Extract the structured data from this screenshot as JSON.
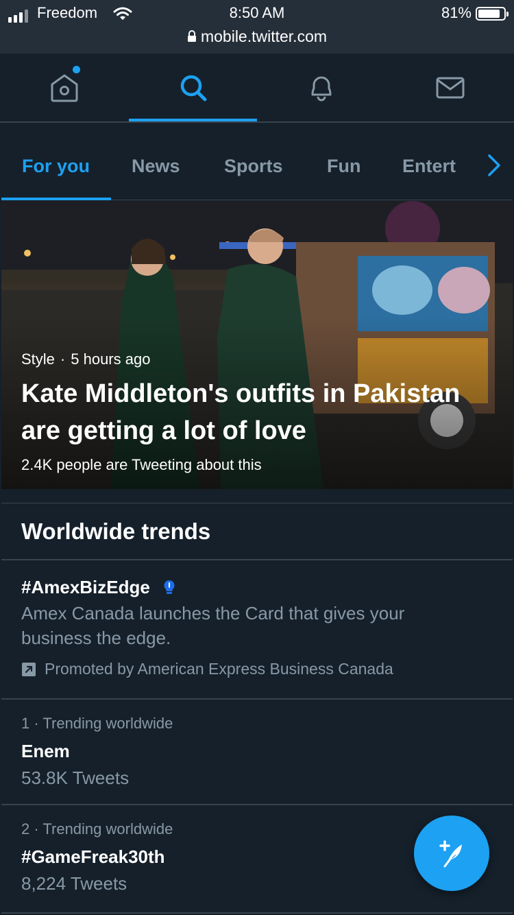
{
  "status_bar": {
    "carrier": "Freedom",
    "time": "8:50 AM",
    "battery_percent": "81%",
    "url": "mobile.twitter.com"
  },
  "top_nav": {
    "items": [
      "home-icon",
      "search-icon",
      "notifications-icon",
      "messages-icon"
    ],
    "active": "search-icon"
  },
  "category_tabs": {
    "items": [
      "For you",
      "News",
      "Sports",
      "Fun",
      "Entert"
    ],
    "active": "For you"
  },
  "hero": {
    "category": "Style",
    "separator": "·",
    "time_ago": "5 hours ago",
    "headline": "Kate Middleton's outfits in Pakistan are getting a lot of love",
    "tweet_count": "2.4K people are Tweeting about this"
  },
  "trends": {
    "title": "Worldwide trends",
    "promoted": {
      "name": "#AmexBizEdge",
      "description": "Amex Canada launches the Card that gives your business the edge.",
      "promoted_by": "Promoted by American Express Business Canada"
    },
    "items": [
      {
        "meta": "1 · Trending worldwide",
        "name": "Enem",
        "count": "53.8K Tweets"
      },
      {
        "meta": "2 · Trending worldwide",
        "name": "#GameFreak30th",
        "count": "8,224 Tweets"
      }
    ]
  },
  "colors": {
    "accent": "#1da1f2",
    "background": "#15202b",
    "secondary_text": "#8899a6",
    "divider": "#38444d"
  }
}
